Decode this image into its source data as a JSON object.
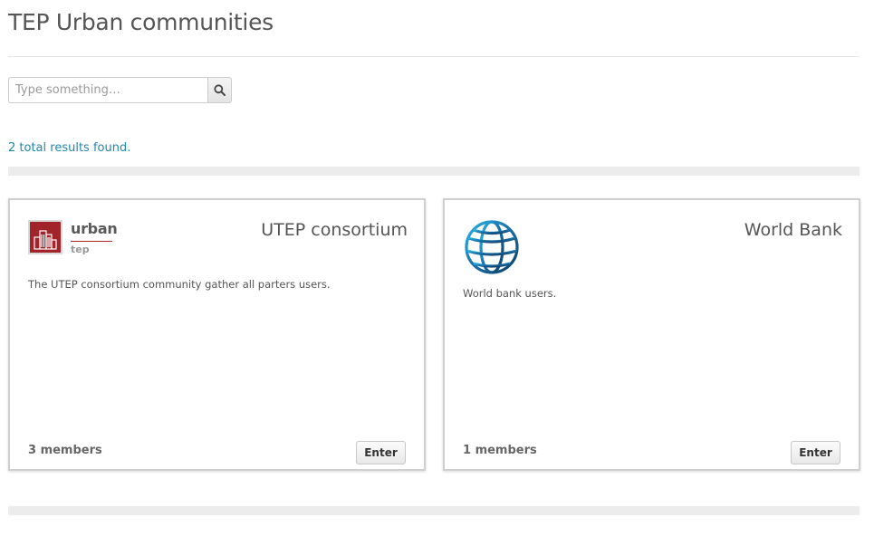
{
  "page": {
    "title": "TEP Urban communities"
  },
  "search": {
    "placeholder": "Type something…",
    "value": "",
    "button_icon": "search-icon"
  },
  "results": {
    "summary": "2 total results found."
  },
  "communities": [
    {
      "title": "UTEP consortium",
      "description": "The UTEP consortium community gather all parters users.",
      "members": "3 members",
      "enter_label": "Enter",
      "logo": {
        "icon": "urban-tep-logo",
        "word": "urban",
        "sub": "tep",
        "color": "#a1242b"
      }
    },
    {
      "title": "World Bank",
      "description": "World bank users.",
      "members": "1 members",
      "enter_label": "Enter",
      "logo": {
        "icon": "world-bank-globe-logo",
        "color": "#1b5585"
      }
    }
  ],
  "colors": {
    "link": "#1f87ad",
    "text": "#555555",
    "divider": "#ececec"
  }
}
